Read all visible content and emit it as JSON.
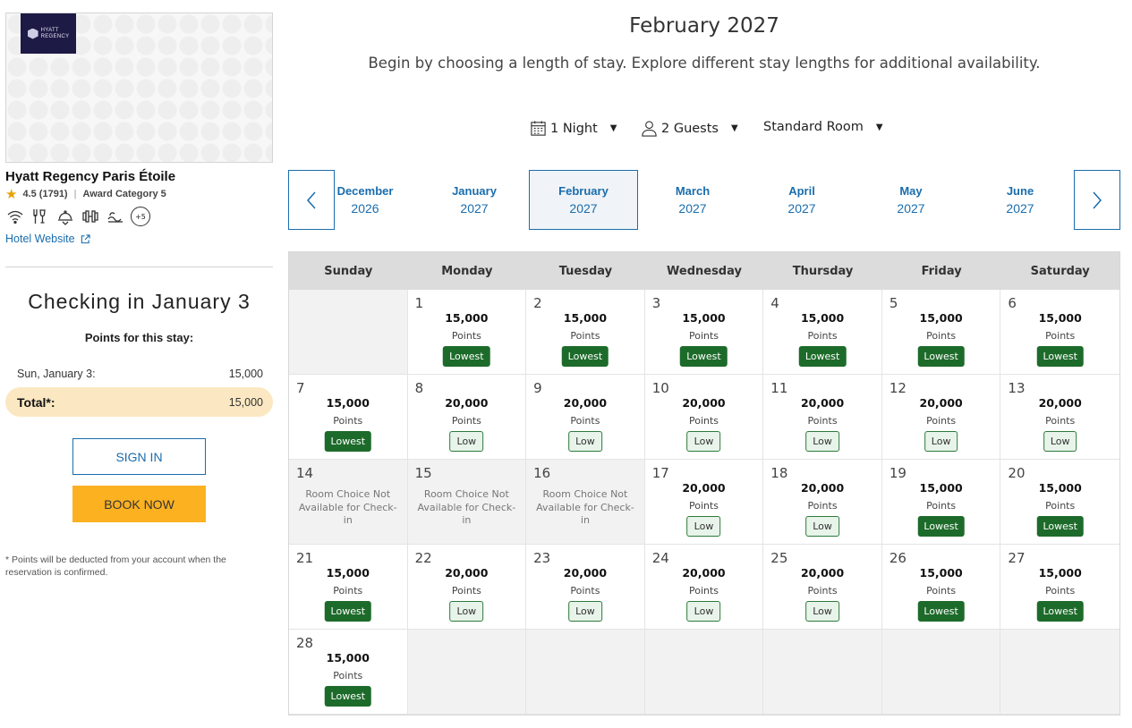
{
  "brand": {
    "logo_line1": "HYATT",
    "logo_line2": "REGENCY"
  },
  "hotel": {
    "name": "Hyatt Regency Paris Étoile",
    "rating": "4.5 (1791)",
    "award_category": "Award Category 5",
    "more_amenities": "+5",
    "website_label": "Hotel Website"
  },
  "summary": {
    "checking_in": "Checking in January 3",
    "points_label": "Points for this stay:",
    "line_item_label": "Sun, January 3:",
    "line_item_value": "15,000",
    "total_label": "Total*:",
    "total_value": "15,000",
    "sign_in": "SIGN IN",
    "book_now": "BOOK NOW",
    "footnote": "* Points will be deducted from your account when the reservation is confirmed."
  },
  "header": {
    "month_title": "February 2027",
    "subtitle": "Begin by choosing a length of stay. Explore different stay lengths for additional availability."
  },
  "filters": {
    "nights": "1 Night",
    "guests": "2 Guests",
    "room": "Standard Room"
  },
  "months": [
    {
      "month": "December",
      "year": "2026"
    },
    {
      "month": "January",
      "year": "2027"
    },
    {
      "month": "February",
      "year": "2027"
    },
    {
      "month": "March",
      "year": "2027"
    },
    {
      "month": "April",
      "year": "2027"
    },
    {
      "month": "May",
      "year": "2027"
    },
    {
      "month": "June",
      "year": "2027"
    }
  ],
  "active_month_index": 2,
  "calendar": {
    "weekdays": [
      "Sunday",
      "Monday",
      "Tuesday",
      "Wednesday",
      "Thursday",
      "Friday",
      "Saturday"
    ],
    "points_unit": "Points",
    "unavailable_text": "Room Choice Not Available for Check-in",
    "leading_blanks": 1,
    "days": [
      {
        "day": "1",
        "points": "15,000",
        "badge": "Lowest"
      },
      {
        "day": "2",
        "points": "15,000",
        "badge": "Lowest"
      },
      {
        "day": "3",
        "points": "15,000",
        "badge": "Lowest"
      },
      {
        "day": "4",
        "points": "15,000",
        "badge": "Lowest"
      },
      {
        "day": "5",
        "points": "15,000",
        "badge": "Lowest"
      },
      {
        "day": "6",
        "points": "15,000",
        "badge": "Lowest"
      },
      {
        "day": "7",
        "points": "15,000",
        "badge": "Lowest"
      },
      {
        "day": "8",
        "points": "20,000",
        "badge": "Low"
      },
      {
        "day": "9",
        "points": "20,000",
        "badge": "Low"
      },
      {
        "day": "10",
        "points": "20,000",
        "badge": "Low"
      },
      {
        "day": "11",
        "points": "20,000",
        "badge": "Low"
      },
      {
        "day": "12",
        "points": "20,000",
        "badge": "Low"
      },
      {
        "day": "13",
        "points": "20,000",
        "badge": "Low"
      },
      {
        "day": "14",
        "unavailable": true
      },
      {
        "day": "15",
        "unavailable": true
      },
      {
        "day": "16",
        "unavailable": true
      },
      {
        "day": "17",
        "points": "20,000",
        "badge": "Low"
      },
      {
        "day": "18",
        "points": "20,000",
        "badge": "Low"
      },
      {
        "day": "19",
        "points": "15,000",
        "badge": "Lowest"
      },
      {
        "day": "20",
        "points": "15,000",
        "badge": "Lowest"
      },
      {
        "day": "21",
        "points": "15,000",
        "badge": "Lowest"
      },
      {
        "day": "22",
        "points": "20,000",
        "badge": "Low"
      },
      {
        "day": "23",
        "points": "20,000",
        "badge": "Low"
      },
      {
        "day": "24",
        "points": "20,000",
        "badge": "Low"
      },
      {
        "day": "25",
        "points": "20,000",
        "badge": "Low"
      },
      {
        "day": "26",
        "points": "15,000",
        "badge": "Lowest"
      },
      {
        "day": "27",
        "points": "15,000",
        "badge": "Lowest"
      },
      {
        "day": "28",
        "points": "15,000",
        "badge": "Lowest"
      }
    ],
    "trailing_blanks": 6
  },
  "colors": {
    "accent": "#1a6dad",
    "lowest": "#1d6b2a",
    "book": "#fcb121",
    "total_bg": "#fbe8c2",
    "star": "#e5a200"
  }
}
